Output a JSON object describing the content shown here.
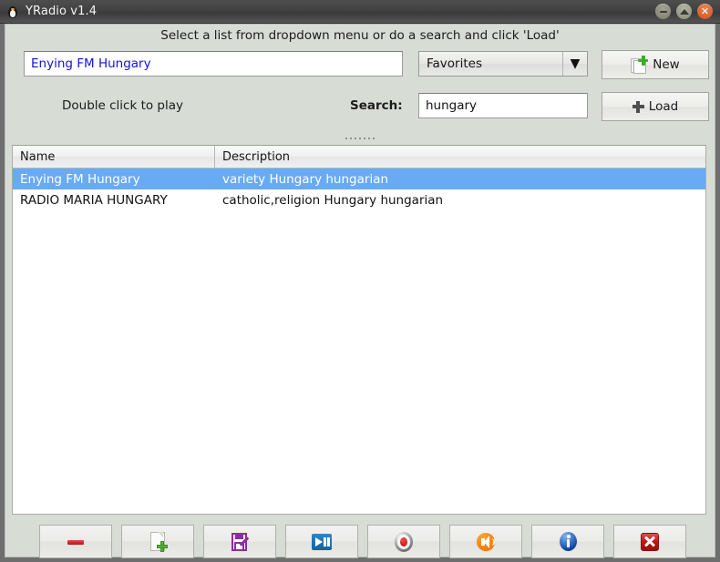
{
  "window": {
    "title": "YRadio v1.4",
    "app_icon": "penguin-icon",
    "buttons": {
      "minimize": "minimize-button",
      "maximize": "maximize-button",
      "close": "close-button"
    }
  },
  "top": {
    "instruction": "Select a list from dropdown menu or do a search and click 'Load'",
    "station_input_value": "Enying FM Hungary",
    "station_input_placeholder": "",
    "list_select_value": "Favorites",
    "new_button_label": "New",
    "double_click_label": "Double click to play",
    "search_label": "Search:",
    "search_input_value": "hungary",
    "search_input_placeholder": "",
    "load_button_label": "Load"
  },
  "list": {
    "columns": [
      "Name",
      "Description"
    ],
    "rows": [
      {
        "name": "Enying FM Hungary",
        "description": "variety Hungary hungarian",
        "selected": true
      },
      {
        "name": "RADIO MARIA HUNGARY",
        "description": "catholic,religion Hungary hungarian",
        "selected": false
      }
    ]
  },
  "toolbar": {
    "buttons": [
      {
        "name": "remove-button",
        "icon": "minus-red-icon"
      },
      {
        "name": "add-button",
        "icon": "document-add-icon"
      },
      {
        "name": "save-button",
        "icon": "floppy-save-icon"
      },
      {
        "name": "play-pause-button",
        "icon": "play-pause-icon"
      },
      {
        "name": "record-button",
        "icon": "record-icon"
      },
      {
        "name": "volume-button",
        "icon": "speaker-volume-icon"
      },
      {
        "name": "info-button",
        "icon": "info-icon"
      },
      {
        "name": "quit-button",
        "icon": "close-x-icon"
      }
    ]
  },
  "colors": {
    "panel_background": "#d7dcd5",
    "window_frame": "#6e6e6e",
    "titlebar": "#414141",
    "selection_blue": "#69aaf5",
    "input_text_blue": "#1212e0",
    "close_orange": "#cf4f20"
  }
}
